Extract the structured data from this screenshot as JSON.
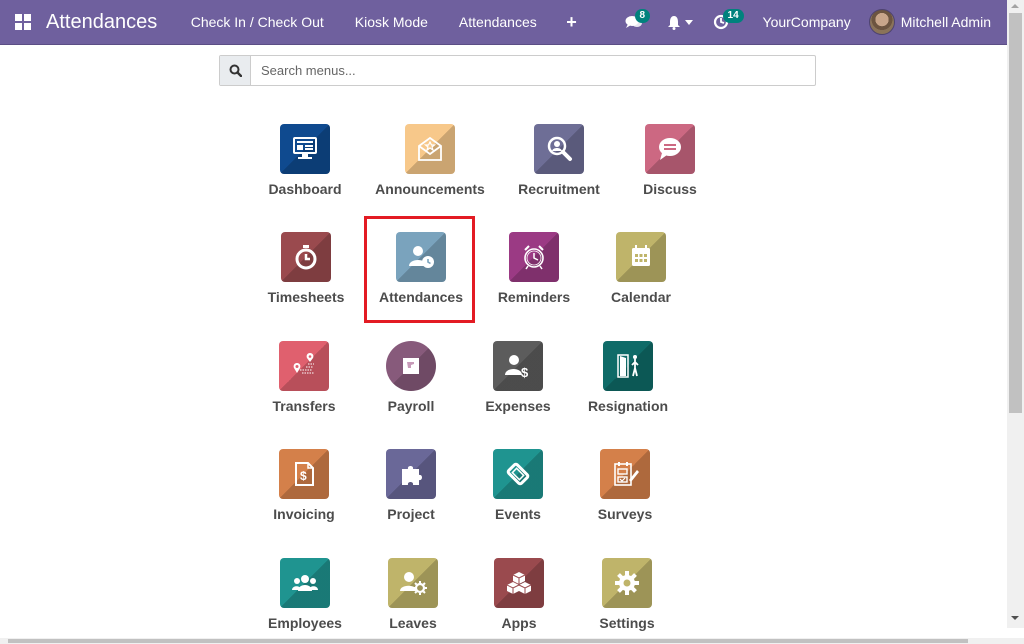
{
  "navbar": {
    "app_title": "Attendances",
    "menu": [
      {
        "label": "Check In / Check Out"
      },
      {
        "label": "Kiosk Mode"
      },
      {
        "label": "Attendances"
      }
    ],
    "add_icon": "plus-icon",
    "messages_badge": "8",
    "activities_badge": "14",
    "company": "YourCompany",
    "user": "Mitchell Admin",
    "background_color": "#6f609e"
  },
  "search": {
    "placeholder": "Search menus...",
    "value": ""
  },
  "apps": [
    {
      "label": "Dashboard",
      "icon": "dashboard-icon",
      "color": "#0f4a8f"
    },
    {
      "label": "Announcements",
      "icon": "announcement-icon",
      "color": "#f7c88a"
    },
    {
      "label": "Recruitment",
      "icon": "recruitment-icon",
      "color": "#6e6e96"
    },
    {
      "label": "Discuss",
      "icon": "discuss-icon",
      "color": "#cc6882"
    },
    {
      "label": "Timesheets",
      "icon": "stopwatch-icon",
      "color": "#9a4a4e"
    },
    {
      "label": "Attendances",
      "icon": "attendance-icon",
      "color": "#7aa3bd"
    },
    {
      "label": "Reminders",
      "icon": "alarm-clock-icon",
      "color": "#9b3a84"
    },
    {
      "label": "Calendar",
      "icon": "calendar-icon",
      "color": "#bfb46a"
    },
    {
      "label": "Transfers",
      "icon": "transfer-icon",
      "color": "#e0606e"
    },
    {
      "label": "Payroll",
      "icon": "payroll-icon",
      "color": "#875a7b"
    },
    {
      "label": "Expenses",
      "icon": "expenses-icon",
      "color": "#5c5c5c"
    },
    {
      "label": "Resignation",
      "icon": "resignation-icon",
      "color": "#0f6b68"
    },
    {
      "label": "Invoicing",
      "icon": "invoice-icon",
      "color": "#d4804a"
    },
    {
      "label": "Project",
      "icon": "puzzle-icon",
      "color": "#6a6898"
    },
    {
      "label": "Events",
      "icon": "ticket-icon",
      "color": "#1f9490"
    },
    {
      "label": "Surveys",
      "icon": "survey-icon",
      "color": "#d4804a"
    },
    {
      "label": "Employees",
      "icon": "employees-icon",
      "color": "#1f9490"
    },
    {
      "label": "Leaves",
      "icon": "leaves-icon",
      "color": "#bfb46a"
    },
    {
      "label": "Apps",
      "icon": "apps-icon",
      "color": "#9a4a4e"
    },
    {
      "label": "Settings",
      "icon": "gear-icon",
      "color": "#bfb46a"
    }
  ],
  "highlighted_app": "Attendances",
  "highlight_color": "#e31b23"
}
